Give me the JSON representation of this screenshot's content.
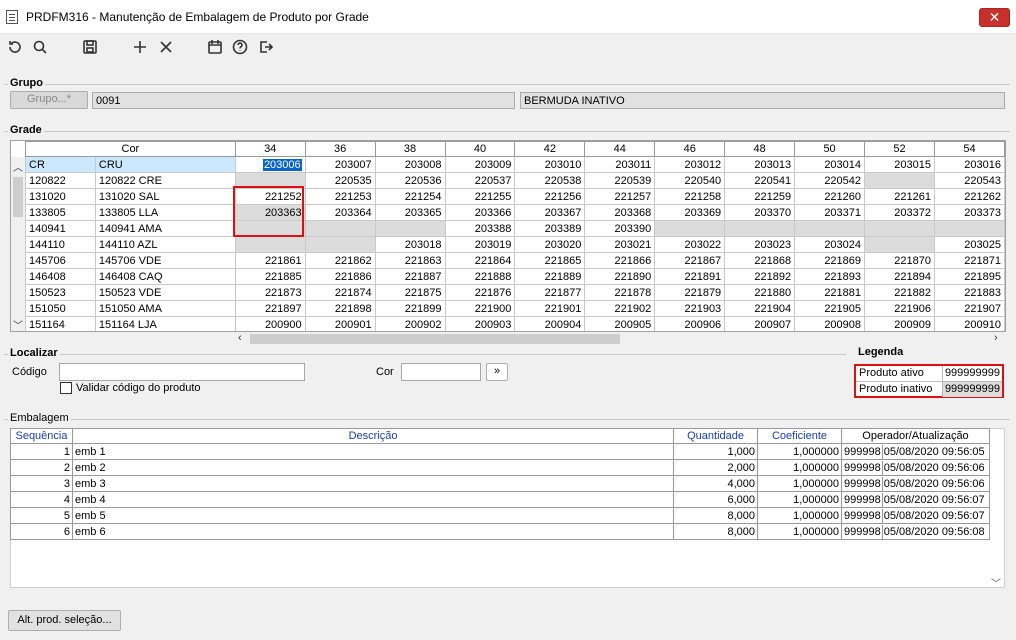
{
  "window": {
    "title": "PRDFM316 - Manutenção de Embalagem de Produto por Grade",
    "close_label": "✕"
  },
  "toolbar": {
    "icons": [
      "refresh-icon",
      "search-icon",
      "save-icon",
      "add-icon",
      "delete-icon",
      "calendar-icon",
      "help-icon",
      "exit-icon"
    ]
  },
  "grupo": {
    "section_label": "Grupo",
    "button_label": "Grupo...*",
    "code": "0091",
    "description": "BERMUDA INATIVO"
  },
  "grade": {
    "section_label": "Grade",
    "columns": [
      "Cor",
      "34",
      "36",
      "38",
      "40",
      "42",
      "44",
      "46",
      "48",
      "50",
      "52",
      "54"
    ],
    "rows": [
      {
        "code": "CR",
        "name": "CRU",
        "cells": [
          "203006",
          "203007",
          "203008",
          "203009",
          "203010",
          "203011",
          "203012",
          "203013",
          "203014",
          "203015",
          "203016"
        ]
      },
      {
        "code": "120822",
        "name": "120822 CRE",
        "cells": [
          "",
          "220535",
          "220536",
          "220537",
          "220538",
          "220539",
          "220540",
          "220541",
          "220542",
          "",
          "220543"
        ]
      },
      {
        "code": "131020",
        "name": "131020 SAL",
        "cells": [
          "221252",
          "221253",
          "221254",
          "221255",
          "221256",
          "221257",
          "221258",
          "221259",
          "221260",
          "221261",
          "221262"
        ]
      },
      {
        "code": "133805",
        "name": "133805 LLA",
        "cells": [
          "203363",
          "203364",
          "203365",
          "203366",
          "203367",
          "203368",
          "203369",
          "203370",
          "203371",
          "203372",
          "203373"
        ]
      },
      {
        "code": "140941",
        "name": "140941 AMA",
        "cells": [
          "",
          "",
          "",
          "203388",
          "203389",
          "203390",
          "",
          "",
          "",
          "",
          ""
        ]
      },
      {
        "code": "144110",
        "name": "144110 AZL",
        "cells": [
          "",
          "",
          "203018",
          "203019",
          "203020",
          "203021",
          "203022",
          "203023",
          "203024",
          "",
          "203025"
        ]
      },
      {
        "code": "145706",
        "name": "145706 VDE",
        "cells": [
          "221861",
          "221862",
          "221863",
          "221864",
          "221865",
          "221866",
          "221867",
          "221868",
          "221869",
          "221870",
          "221871"
        ]
      },
      {
        "code": "146408",
        "name": "146408 CAQ",
        "cells": [
          "221885",
          "221886",
          "221887",
          "221888",
          "221889",
          "221890",
          "221891",
          "221892",
          "221893",
          "221894",
          "221895"
        ]
      },
      {
        "code": "150523",
        "name": "150523 VDE",
        "cells": [
          "221873",
          "221874",
          "221875",
          "221876",
          "221877",
          "221878",
          "221879",
          "221880",
          "221881",
          "221882",
          "221883"
        ]
      },
      {
        "code": "151050",
        "name": "151050 AMA",
        "cells": [
          "221897",
          "221898",
          "221899",
          "221900",
          "221901",
          "221902",
          "221903",
          "221904",
          "221905",
          "221906",
          "221907"
        ]
      },
      {
        "code": "151164",
        "name": "151164 LJA",
        "cells": [
          "200900",
          "200901",
          "200902",
          "200903",
          "200904",
          "200905",
          "200906",
          "200907",
          "200908",
          "200909",
          "200910"
        ]
      }
    ]
  },
  "localizar": {
    "section_label": "Localizar",
    "codigo_label": "Código",
    "codigo_value": "",
    "validar_label": "Validar código do produto",
    "cor_label": "Cor",
    "cor_value": "",
    "go_label": "»"
  },
  "legenda": {
    "section_label": "Legenda",
    "ativo_label": "Produto ativo",
    "ativo_value": "999999999",
    "inativo_label": "Produto inativo",
    "inativo_value": "999999999"
  },
  "embalagem": {
    "section_label": "Embalagem",
    "headers": [
      "Sequência",
      "Descrição",
      "Quantidade",
      "Coeficiente",
      "Operador/Atualização"
    ],
    "rows": [
      {
        "seq": "1",
        "desc": "emb 1",
        "qtd": "1,000",
        "coef": "1,000000",
        "op": "999998",
        "dt": "05/08/2020 09:56:05"
      },
      {
        "seq": "2",
        "desc": "emb 2",
        "qtd": "2,000",
        "coef": "1,000000",
        "op": "999998",
        "dt": "05/08/2020 09:56:06"
      },
      {
        "seq": "3",
        "desc": "emb 3",
        "qtd": "4,000",
        "coef": "1,000000",
        "op": "999998",
        "dt": "05/08/2020 09:56:06"
      },
      {
        "seq": "4",
        "desc": "emb 4",
        "qtd": "6,000",
        "coef": "1,000000",
        "op": "999998",
        "dt": "05/08/2020 09:56:07"
      },
      {
        "seq": "5",
        "desc": "emb 5",
        "qtd": "8,000",
        "coef": "1,000000",
        "op": "999998",
        "dt": "05/08/2020 09:56:07"
      },
      {
        "seq": "6",
        "desc": "emb 6",
        "qtd": "8,000",
        "coef": "1,000000",
        "op": "999998",
        "dt": "05/08/2020 09:56:08"
      }
    ]
  },
  "footer": {
    "alt_button_label": "Alt. prod. seleção..."
  },
  "colors": {
    "selection": "#0a64c8",
    "highlight_border": "#dd1111",
    "inactive_cell": "#dcdcdc"
  }
}
